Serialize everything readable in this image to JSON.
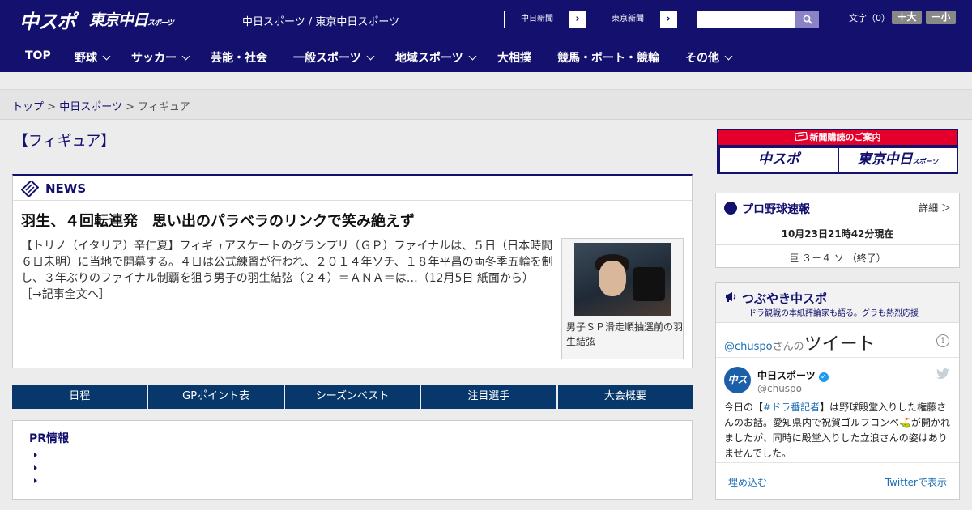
{
  "header": {
    "logo_main": "中スポ",
    "logo_tokyo": "東京中日",
    "logo_tokyo_small": "スポーツ",
    "site_title": "中日スポーツ / 東京中日スポーツ",
    "np_buttons": [
      {
        "label": "中日新聞",
        "arrow": "›"
      },
      {
        "label": "東京新聞",
        "arrow": "›"
      }
    ],
    "search_placeholder": "",
    "font_size_label": "文字（0）",
    "font_larger": "＋大",
    "font_smaller": "－小"
  },
  "nav": {
    "items": [
      {
        "label": "TOP",
        "has_dropdown": false
      },
      {
        "label": "野球",
        "has_dropdown": true
      },
      {
        "label": "サッカー",
        "has_dropdown": true
      },
      {
        "label": "芸能・社会",
        "has_dropdown": false
      },
      {
        "label": "一般スポーツ",
        "has_dropdown": true
      },
      {
        "label": "地域スポーツ",
        "has_dropdown": true
      },
      {
        "label": "大相撲",
        "has_dropdown": false
      },
      {
        "label": "競馬・ボート・競輪",
        "has_dropdown": false
      },
      {
        "label": "その他",
        "has_dropdown": true
      }
    ]
  },
  "breadcrumb": {
    "items": [
      "トップ",
      "中日スポーツ",
      "フィギュア"
    ],
    "separator": ">"
  },
  "page_title": "【フィギュア】",
  "news": {
    "label": "NEWS",
    "headline": "羽生、４回転連発　思い出のパラベラのリンクで笑み絶えず",
    "body": "【トリノ（イタリア）辛仁夏】フィギュアスケートのグランプリ（ＧＰ）ファイナルは、５日（日本時間６日未明）に当地で開幕する。４日は公式練習が行われ、２０１４年ソチ、１８年平昌の両冬季五輪を制し、３年ぶりのファイナル制覇を狙う男子の羽生結弦（２４）＝ＡＮＡ＝は…（12月5日 紙面から）",
    "read_more": "［→記事全文へ］",
    "photo_caption": "男子ＳＰ滑走順抽選前の羽生結弦"
  },
  "tabs": [
    "日程",
    "GPポイント表",
    "シーズンベスト",
    "注目選手",
    "大会概要"
  ],
  "pr": {
    "title": "PR情報"
  },
  "sidebar": {
    "subscription": {
      "title": "新聞購読のご案内",
      "logo_left": "中スポ",
      "logo_right": "東京中日",
      "logo_right_small": "スポーツ"
    },
    "pro_baseball": {
      "title": "プロ野球速報",
      "detail": "詳細 ＞",
      "time": "10月23日21時42分現在",
      "score": "巨 ３－４ ソ （終了）"
    },
    "twitter": {
      "title": "つぶやき中スポ",
      "subtitle": "ドラ観戦の本紙評論家も語る。グラも熱烈応援",
      "handle_link": "@chuspo",
      "handle_suffix": "さんの",
      "tweet_word": "ツイート",
      "info_icon": "i",
      "avatar_text": "中スポ",
      "user_name": "中日スポーツ",
      "user_handle": "@chuspo",
      "tweet_pre": "今日の【",
      "tweet_tag": "#ドラ番記者",
      "tweet_post": "】は野球殿堂入りした権藤さんのお話。愛知県内で祝賀ゴルフコンペ⛳が開かれましたが、同時に殿堂入りした立浪さんの姿はありませんでした。",
      "embed": "埋め込む",
      "view_on_twitter": "Twitterで表示"
    }
  },
  "colors": {
    "header_navy": "#13106e",
    "tab_blue": "#07376b",
    "accent_red": "#e4002b",
    "link_blue": "#1b6fb5"
  }
}
